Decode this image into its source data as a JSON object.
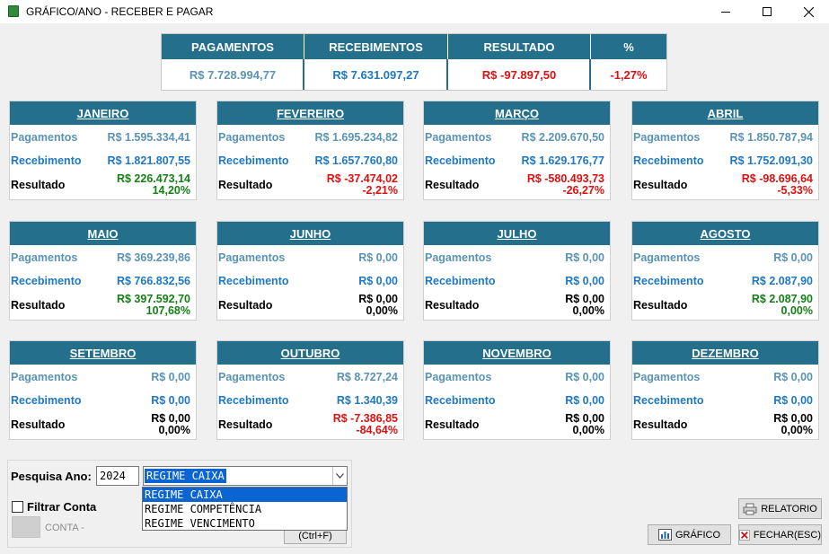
{
  "window": {
    "title": "GRÁFICO/ANO - RECEBER E PAGAR"
  },
  "summary": {
    "headers": [
      "PAGAMENTOS",
      "RECEBIMENTOS",
      "RESULTADO",
      "%"
    ],
    "values": [
      "R$ 7.728.994,77",
      "R$ 7.631.097,27",
      "R$ -97.897,50",
      "-1,27%"
    ]
  },
  "labels": {
    "pagamentos": "Pagamentos",
    "recebimento": "Recebimento",
    "resultado": "Resultado"
  },
  "months": [
    {
      "name": "JANEIRO",
      "pag": "R$ 1.595.334,41",
      "rec": "R$ 1.821.807,55",
      "res": "R$ 226.473,14",
      "pct": "14,20%",
      "sign": "pos"
    },
    {
      "name": "FEVEREIRO",
      "pag": "R$ 1.695.234,82",
      "rec": "R$ 1.657.760,80",
      "res": "R$ -37.474,02",
      "pct": "-2,21%",
      "sign": "neg"
    },
    {
      "name": "MARÇO",
      "pag": "R$ 2.209.670,50",
      "rec": "R$ 1.629.176,77",
      "res": "R$ -580.493,73",
      "pct": "-26,27%",
      "sign": "neg"
    },
    {
      "name": "ABRIL",
      "pag": "R$ 1.850.787,94",
      "rec": "R$ 1.752.091,30",
      "res": "R$ -98.696,64",
      "pct": "-5,33%",
      "sign": "neg"
    },
    {
      "name": "MAIO",
      "pag": "R$ 369.239,86",
      "rec": "R$ 766.832,56",
      "res": "R$ 397.592,70",
      "pct": "107,68%",
      "sign": "pos"
    },
    {
      "name": "JUNHO",
      "pag": "R$ 0,00",
      "rec": "R$ 0,00",
      "res": "R$ 0,00",
      "pct": "0,00%",
      "sign": "zero"
    },
    {
      "name": "JULHO",
      "pag": "R$ 0,00",
      "rec": "R$ 0,00",
      "res": "R$ 0,00",
      "pct": "0,00%",
      "sign": "zero"
    },
    {
      "name": "AGOSTO",
      "pag": "R$ 0,00",
      "rec": "R$ 2.087,90",
      "res": "R$ 2.087,90",
      "pct": "0,00%",
      "sign": "pos"
    },
    {
      "name": "SETEMBRO",
      "pag": "R$ 0,00",
      "rec": "R$ 0,00",
      "res": "R$ 0,00",
      "pct": "0,00%",
      "sign": "zero"
    },
    {
      "name": "OUTUBRO",
      "pag": "R$ 8.727,24",
      "rec": "R$ 1.340,39",
      "res": "R$ -7.386,85",
      "pct": "-84,64%",
      "sign": "neg"
    },
    {
      "name": "NOVEMBRO",
      "pag": "R$ 0,00",
      "rec": "R$ 0,00",
      "res": "R$ 0,00",
      "pct": "0,00%",
      "sign": "zero"
    },
    {
      "name": "DEZEMBRO",
      "pag": "R$ 0,00",
      "rec": "R$ 0,00",
      "res": "R$ 0,00",
      "pct": "0,00%",
      "sign": "zero"
    }
  ],
  "filters": {
    "year_label": "Pesquisa Ano:",
    "year_value": "2024",
    "regime_selected": "REGIME CAIXA",
    "regime_options": [
      "REGIME CAIXA",
      "REGIME COMPETÊNCIA",
      "REGIME VENCIMENTO"
    ],
    "filtrar_conta_label": "Filtrar Conta",
    "conta_label": "CONTA  -",
    "ctrlf_label": "(Ctrl+F)"
  },
  "buttons": {
    "relatorio": "RELATORIO",
    "grafico": "GRÁFICO",
    "fechar": "FECHAR(ESC)"
  },
  "colors": {
    "header_bg": "#246f8b",
    "pagamentos": "#5a93b3",
    "recebimento": "#1f78c4",
    "positive": "#168016",
    "negative": "#e01010",
    "selection": "#0a64d2"
  },
  "icons": {
    "app": "app-icon",
    "relatorio": "printer-icon",
    "grafico": "chart-icon",
    "fechar": "close-icon"
  }
}
